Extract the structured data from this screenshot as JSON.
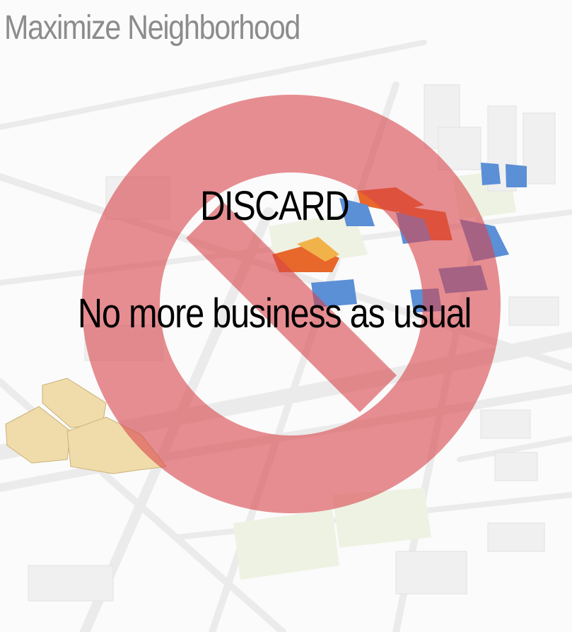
{
  "title": "Maximize Neighborhood",
  "sign": {
    "headline": "DISCARD",
    "subline": "No more business as usual",
    "color": "#d9454b",
    "icon": "no-entry-prohibition-icon"
  },
  "background": {
    "description_icon": "city-map-3d-icon",
    "road_color": "#ebebeb",
    "park_color": "#eef2e3",
    "highlight_colors": [
      "#e8672a",
      "#5b8fd6",
      "#f0dcaa",
      "#f2b24a"
    ]
  }
}
